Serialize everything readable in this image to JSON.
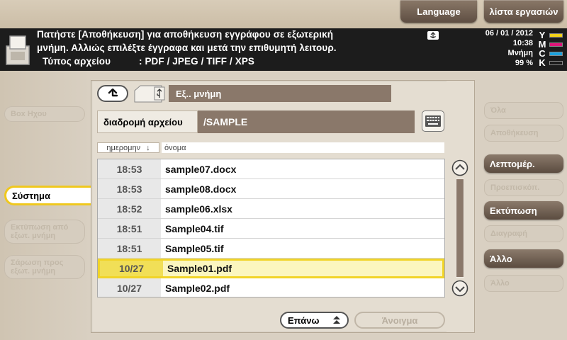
{
  "header": {
    "language_button": "Language",
    "job_list_button": "λίστα εργασιών"
  },
  "message": {
    "line1": "Πατήστε [Αποθήκευση] για αποθήκευση εγγράφου σε εξωτερική",
    "line2": "μνήμη. Αλλιώς επιλέξτε έγγραφα και μετά την επιθυμητή λειτουρ.",
    "filetype_label": "Τύπος αρχείου",
    "filetype_value": ": PDF / JPEG / TIFF / XPS"
  },
  "status": {
    "date": "06 / 01 / 2012",
    "time": "10:38",
    "memory_label": "Μνήμη",
    "memory_value": "99 %",
    "toner": [
      {
        "letter": "Y",
        "color": "#f2d21b"
      },
      {
        "letter": "M",
        "color": "#e0157a"
      },
      {
        "letter": "C",
        "color": "#1aa3df"
      },
      {
        "letter": "K",
        "color": "#1a1a1a"
      }
    ]
  },
  "left_menu": {
    "ghost_top": "Box Ηχου",
    "system_tab": "Σύστημα",
    "ghost_mid": "Εκτύπωση από εξωτ. μνήμη",
    "ghost_bottom": "Σάρωση προς εξωτ. μνήμη"
  },
  "location": {
    "title": "Εξ.. μνήμη",
    "path_label": "διαδρομή αρχείου",
    "path_value": "/SAMPLE"
  },
  "sort": {
    "date_label": "ημερομην",
    "date_arrow": "↓",
    "name_label": "όνομα"
  },
  "files": [
    {
      "time": "18:53",
      "name": "sample07.docx",
      "selected": false
    },
    {
      "time": "18:53",
      "name": "sample08.docx",
      "selected": false
    },
    {
      "time": "18:52",
      "name": "sample06.xlsx",
      "selected": false
    },
    {
      "time": "18:51",
      "name": "Sample04.tif",
      "selected": false
    },
    {
      "time": "18:51",
      "name": "Sample05.tif",
      "selected": false
    },
    {
      "time": "10/27",
      "name": "Sample01.pdf",
      "selected": true
    },
    {
      "time": "10/27",
      "name": "Sample02.pdf",
      "selected": false
    }
  ],
  "bottom": {
    "top_button": "Επάνω",
    "open_button": "Άνοιγμα"
  },
  "right_menu": {
    "ghost1": "Όλα",
    "ghost2": "Αποθήκευση",
    "details": "Λεπτομέρ.",
    "ghost3": "Προεπισκόπ.",
    "print": "Εκτύπωση",
    "ghost4": "Διαγραφή",
    "other": "Άλλο",
    "ghost5": "Άλλο"
  }
}
